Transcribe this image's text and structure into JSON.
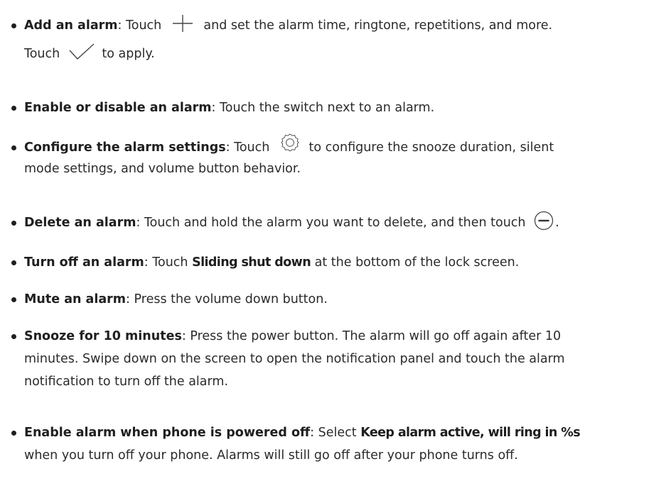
{
  "items": [
    {
      "title": "Add an alarm",
      "sep": ": ",
      "pre": "Touch",
      "icon": "plus-icon",
      "post": "and set the alarm time, ringtone, repetitions, and more.",
      "line2_pre": "Touch",
      "line2_icon": "check-icon",
      "line2_post": "to apply."
    },
    {
      "title": "Enable or disable an alarm",
      "sep": ": ",
      "text": "Touch the switch next to an alarm."
    },
    {
      "title": "Configure the alarm settings",
      "sep": ": ",
      "pre": "Touch",
      "icon": "settings-gear-icon",
      "post": "to configure the snooze duration, silent",
      "line2": "mode settings, and volume button behavior."
    },
    {
      "title": "Delete an alarm",
      "sep": ": ",
      "pre": "Touch and hold the alarm you want to delete, and then touch",
      "icon": "minus-circle-icon",
      "post": "."
    },
    {
      "title": "Turn off an alarm",
      "sep": ": ",
      "pre": "Touch",
      "bold": "Sliding shut down",
      "post": "at the bottom of the lock screen."
    },
    {
      "title": "Mute an alarm",
      "sep": ": ",
      "text": "Press the volume down button."
    },
    {
      "title": "Snooze for 10 minutes",
      "sep": ": ",
      "line1": "Press the power button. The alarm will go off again after 10",
      "line2": "minutes. Swipe down on the screen to open the notification panel and touch the alarm",
      "line3": "notification to turn off the alarm."
    },
    {
      "title": "Enable alarm when phone is powered off",
      "sep": ": ",
      "pre": "Select",
      "bold": "Keep alarm active, will ring in %s",
      "line2": "when you turn off your phone. Alarms will still go off after your phone turns off."
    }
  ],
  "colors": {
    "text": "#2b2b2b",
    "bold": "#1f1f1f",
    "icon": "#444444"
  }
}
